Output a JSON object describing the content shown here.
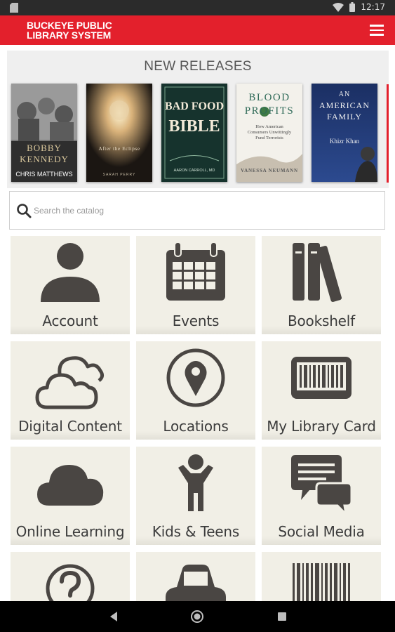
{
  "status_bar": {
    "time": "12:17"
  },
  "app_bar": {
    "logo_line1": "BUCKEYE PUBLIC",
    "logo_line2": "LIBRARY SYSTEM",
    "menu_icon": "hamburger-menu-icon"
  },
  "new_releases": {
    "title": "NEW RELEASES",
    "books": [
      {
        "title_line1": "BOBBY",
        "title_line2": "KENNEDY",
        "author": "CHRIS MATTHEWS"
      },
      {
        "title": "After the Eclipse",
        "author": "SARAH PERRY"
      },
      {
        "title_line1": "BAD FOOD",
        "title_line2": "BIBLE",
        "author": "AARON CARROLL, MD"
      },
      {
        "title_line1": "BLOOD",
        "title_line2": "PROFITS",
        "subtitle": "How American Consumers Unwittingly Fund Terrorists",
        "author": "VANESSA NEUMANN"
      },
      {
        "title_line1": "AN",
        "title_line2": "AMERICAN",
        "title_line3": "FAMILY",
        "author": "Khizr Khan"
      }
    ]
  },
  "search": {
    "placeholder": "Search the catalog",
    "icon": "search-icon"
  },
  "tiles": [
    {
      "label": "Account",
      "icon": "person-icon"
    },
    {
      "label": "Events",
      "icon": "calendar-icon"
    },
    {
      "label": "Bookshelf",
      "icon": "books-icon"
    },
    {
      "label": "Digital Content",
      "icon": "cloud-icon"
    },
    {
      "label": "Locations",
      "icon": "map-pin-icon"
    },
    {
      "label": "My Library Card",
      "icon": "barcode-card-icon"
    },
    {
      "label": "Online Learning",
      "icon": "cloud-filled-icon"
    },
    {
      "label": "Kids & Teens",
      "icon": "child-icon"
    },
    {
      "label": "Social Media",
      "icon": "chat-bubbles-icon"
    },
    {
      "label": "",
      "icon": "question-icon"
    },
    {
      "label": "",
      "icon": "car-icon"
    },
    {
      "label": "",
      "icon": "barcode-icon"
    }
  ],
  "colors": {
    "brand_red": "#e3202c",
    "icon_gray": "#4a4643",
    "tile_bg": "#f1efe6"
  }
}
